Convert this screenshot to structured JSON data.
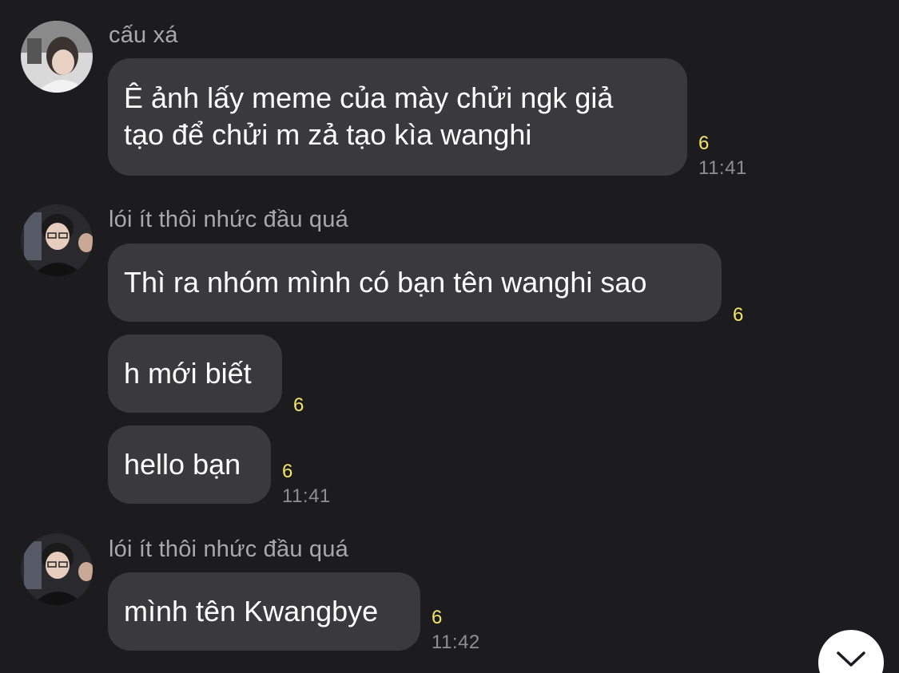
{
  "messages": [
    {
      "sender": "cấu xá",
      "text_lines": [
        "Ê ảnh lấy meme của mày chửi ngk giả",
        "tạo để chửi m zả tạo kìa wanghi"
      ],
      "count": "6",
      "time": "11:41"
    },
    {
      "sender": "lói ít thôi nhức đầu quá",
      "text": "Thì ra nhóm mình có bạn tên wanghi sao",
      "count": "6"
    },
    {
      "text": "h mới biết",
      "count": "6"
    },
    {
      "text": "hello bạn",
      "count": "6",
      "time": "11:41"
    },
    {
      "sender": "lói ít thôi nhức đầu quá",
      "text": "mình tên Kwangbye",
      "count": "6",
      "time": "11:42"
    }
  ],
  "scroll_button": {
    "icon": "chevron-down-icon"
  },
  "colors": {
    "background": "#1c1c1e",
    "bubble": "#3a3a3c",
    "count": "#f4e56a",
    "sender": "#a8a8ad",
    "time": "#8e8e93"
  }
}
